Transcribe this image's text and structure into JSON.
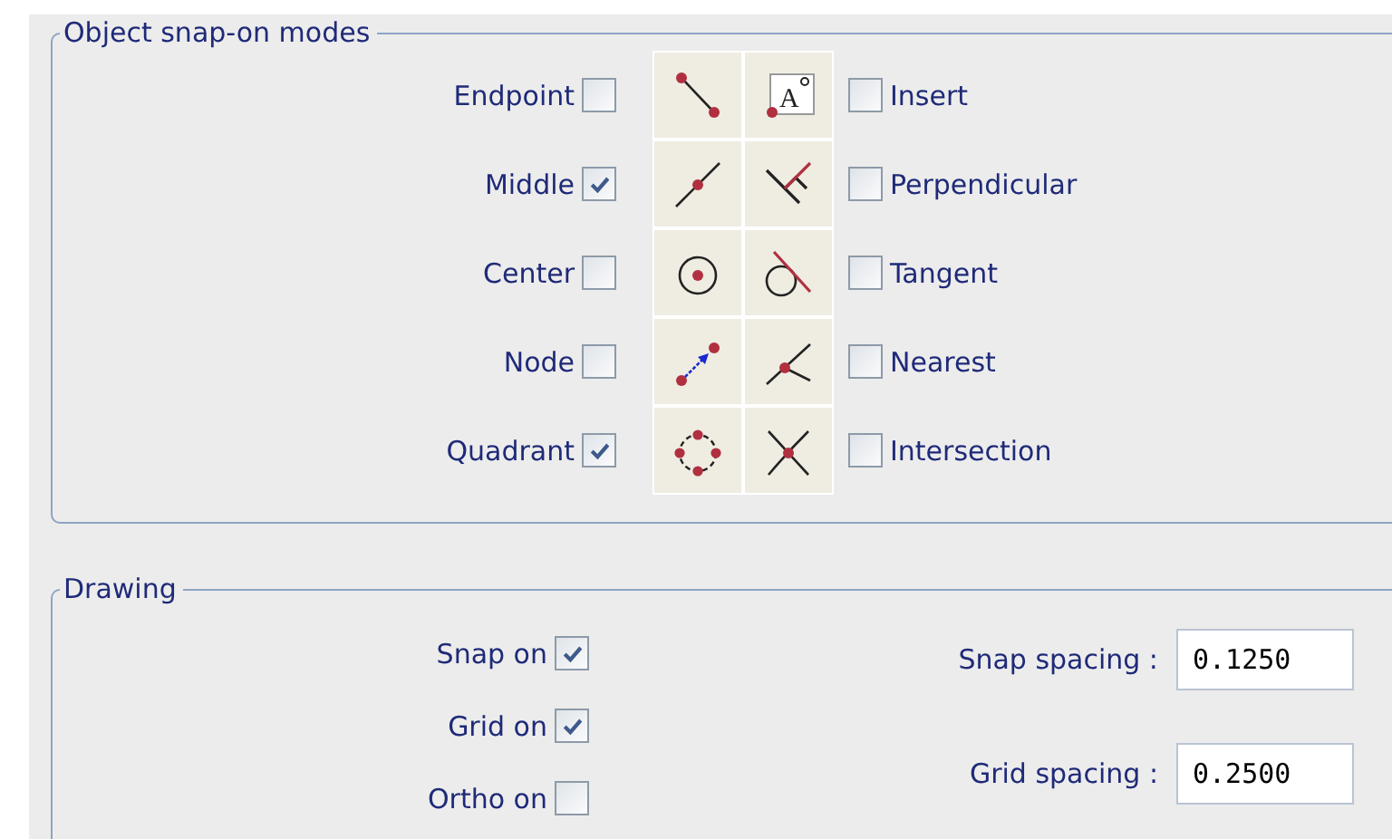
{
  "snap_modes": {
    "title": "Object snap-on modes",
    "left_modes": [
      {
        "label": "Endpoint",
        "checked": false,
        "kind": "endpoint"
      },
      {
        "label": "Middle",
        "checked": true,
        "kind": "middle"
      },
      {
        "label": "Center",
        "checked": false,
        "kind": "center"
      },
      {
        "label": "Node",
        "checked": false,
        "kind": "node"
      },
      {
        "label": "Quadrant",
        "checked": true,
        "kind": "quadrant"
      }
    ],
    "right_modes": [
      {
        "label": "Insert",
        "checked": false,
        "kind": "insert",
        "icon_glyph": "A"
      },
      {
        "label": "Perpendicular",
        "checked": false,
        "kind": "perpendicular"
      },
      {
        "label": "Tangent",
        "checked": false,
        "kind": "tangent"
      },
      {
        "label": "Nearest",
        "checked": false,
        "kind": "nearest"
      },
      {
        "label": "Intersection",
        "checked": false,
        "kind": "intersection"
      }
    ]
  },
  "drawing": {
    "title": "Drawing",
    "toggles": [
      {
        "label": "Snap on",
        "checked": true
      },
      {
        "label": "Grid on",
        "checked": true
      },
      {
        "label": "Ortho on",
        "checked": false
      }
    ],
    "fields": [
      {
        "label": "Snap spacing :",
        "value": "0.1250"
      },
      {
        "label": "Grid spacing :",
        "value": "0.2500"
      }
    ]
  }
}
